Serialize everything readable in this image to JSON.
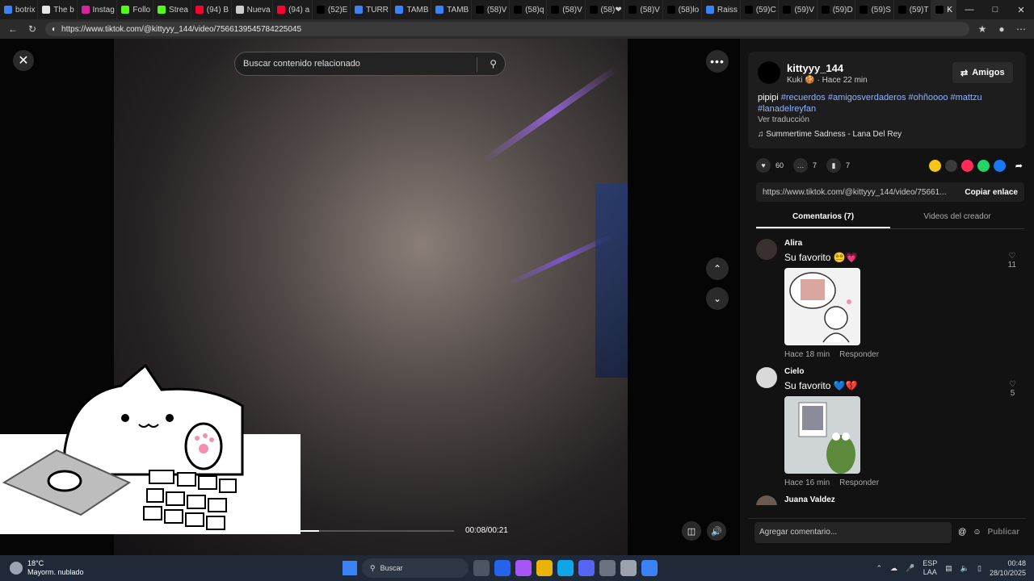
{
  "browser": {
    "tabs": [
      {
        "label": "botrix",
        "color": "#3b82f6"
      },
      {
        "label": "The b",
        "color": "#e6e6e6"
      },
      {
        "label": "Instag",
        "color": "#d6249f"
      },
      {
        "label": "Follo",
        "color": "#53fc18"
      },
      {
        "label": "Strea",
        "color": "#53fc18"
      },
      {
        "label": "(94) B",
        "color": "#ff0033"
      },
      {
        "label": "Nueva",
        "color": "#cccccc"
      },
      {
        "label": "(94) a",
        "color": "#ff0033"
      },
      {
        "label": "(52)E",
        "color": "#000000"
      },
      {
        "label": "TURR",
        "color": "#3b82f6"
      },
      {
        "label": "TAMB",
        "color": "#3b82f6"
      },
      {
        "label": "TAMB",
        "color": "#3b82f6"
      },
      {
        "label": "(58)V",
        "color": "#000000"
      },
      {
        "label": "(58)q",
        "color": "#000000"
      },
      {
        "label": "(58)V",
        "color": "#000000"
      },
      {
        "label": "(58)❤",
        "color": "#000000"
      },
      {
        "label": "(58)V",
        "color": "#000000"
      },
      {
        "label": "(58)lo",
        "color": "#000000"
      },
      {
        "label": "Raiss",
        "color": "#3b82f6"
      },
      {
        "label": "(59)C",
        "color": "#000000"
      },
      {
        "label": "(59)V",
        "color": "#000000"
      },
      {
        "label": "(59)D",
        "color": "#000000"
      },
      {
        "label": "(59)S",
        "color": "#000000"
      },
      {
        "label": "(59)T",
        "color": "#000000"
      },
      {
        "label": "K",
        "color": "#000000"
      }
    ],
    "url": "https://www.tiktok.com/@kittyyy_144/video/7566139545784225045"
  },
  "player": {
    "search_placeholder": "Buscar contenido relacionado",
    "timecode": "00:08/00:21",
    "progress": 0.12
  },
  "post": {
    "username": "kittyyy_144",
    "nickname": "Kuki 🍪",
    "time": "Hace 22 min",
    "follow_label": "Amigos",
    "caption": "pipipi",
    "hashtags": [
      "#recuerdos",
      "#amigosverdaderos",
      "#ohñoooo",
      "#mattzu",
      "#lanadelreyfan"
    ],
    "translate": "Ver traducción",
    "music": "Summertime Sadness - Lana Del Rey",
    "likes": "60",
    "comments": "7",
    "saves": "7",
    "link": "https://www.tiktok.com/@kittyyy_144/video/75661...",
    "copy_label": "Copiar enlace",
    "share_colors": [
      "#f5c518",
      "#3a3a3a",
      "#fe2c55",
      "#25d366",
      "#1877f2"
    ]
  },
  "tabs": {
    "comments": "Comentarios (7)",
    "creator": "Videos del creador"
  },
  "comments": [
    {
      "name": "Alira",
      "text": "Su favorito 😵‍💫💗",
      "time": "Hace 18 min",
      "reply": "Responder",
      "likes": "11"
    },
    {
      "name": "Cielo",
      "text": "Su favorito 💙💔",
      "time": "Hace 16 min",
      "reply": "Responder",
      "likes": "5"
    },
    {
      "name": "Juana Valdez"
    }
  ],
  "comment_box": {
    "placeholder": "Agregar comentario...",
    "post_label": "Publicar"
  },
  "taskbar": {
    "temp": "18°C",
    "weather": "Mayorm. nublado",
    "search": "Buscar",
    "lang": "ESP",
    "lang2": "LAA",
    "time": "00:48",
    "date": "28/10/2025"
  }
}
